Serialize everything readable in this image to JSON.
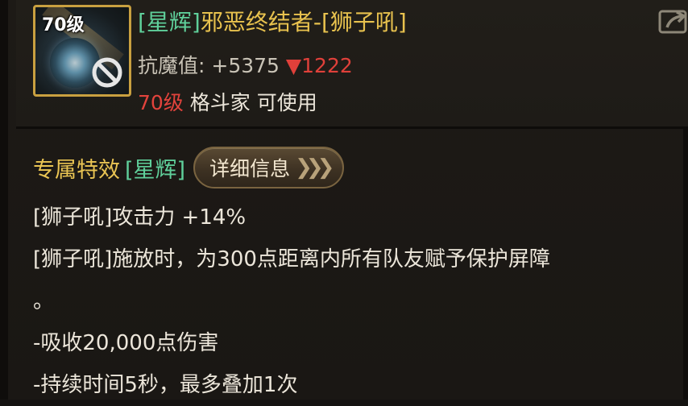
{
  "item": {
    "level_tag": "70级",
    "title_tag": "[星辉]",
    "title_name": "邪恶终结者-[狮子吼]",
    "stat_label": "抗魔值: ",
    "stat_value": "+5375",
    "stat_delta": "▼1222",
    "req_level": "70级",
    "req_class": " 格斗家 可使用",
    "icon": "fist-gauntlet-icon"
  },
  "effects": {
    "section_title": "专属特效",
    "section_tag": "[星辉]",
    "detail_button_label": "详细信息",
    "lines": [
      "[狮子吼]攻击力 +14%",
      "[狮子吼]施放时，为300点距离内所有队友赋予保护屏障",
      "。",
      "-吸收20,000点伤害",
      "-持续时间5秒，最多叠加1次"
    ]
  },
  "colors": {
    "gold": "#e8c24e",
    "green": "#5fcf9a",
    "red": "#e0403a",
    "text": "#ece6da"
  }
}
